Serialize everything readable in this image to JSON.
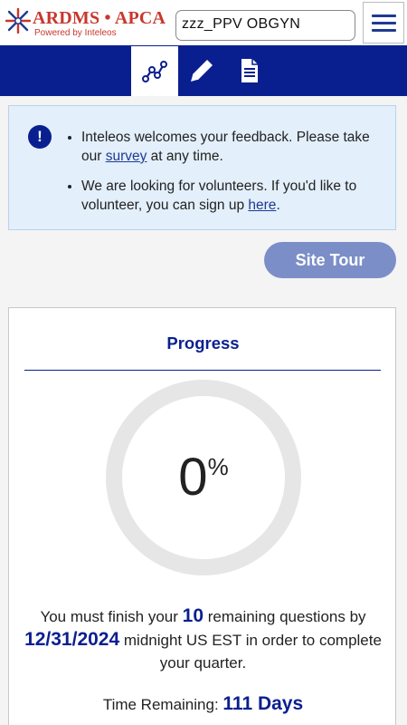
{
  "header": {
    "logo_text": "ARDMS • APCA",
    "logo_sub": "Powered by Inteleos",
    "program": "zzz_PPV OBGYN",
    "menu_icon": "hamburger-menu-icon"
  },
  "nav": {
    "tabs": [
      {
        "icon": "progress-chart-icon",
        "active": true
      },
      {
        "icon": "pencil-icon",
        "active": false
      },
      {
        "icon": "document-icon",
        "active": false
      }
    ]
  },
  "alert": {
    "icon": "exclamation-icon",
    "item1_before": "Inteleos welcomes your feedback. Please take our ",
    "item1_link": "survey",
    "item1_after": " at any time.",
    "item2_before": "We are looking for volunteers. If you'd like to volunteer, you can sign up ",
    "item2_link": "here",
    "item2_after": "."
  },
  "site_tour_label": "Site Tour",
  "progress": {
    "title": "Progress",
    "percent_value": "0",
    "percent_sign": "%",
    "progress_fraction": 0,
    "finish_part1": "You must finish your ",
    "remaining_count": "10",
    "finish_part2": " remaining questions by ",
    "deadline": "12/31/2024",
    "finish_part3": " midnight US EST in order to complete your quarter.",
    "time_label": "Time Remaining: ",
    "time_value": "111 Days"
  },
  "colors": {
    "brand_red": "#c8372d",
    "nav_blue": "#0a1f8f",
    "tour_button": "#7b8ec8",
    "alert_bg": "#e3effa"
  }
}
